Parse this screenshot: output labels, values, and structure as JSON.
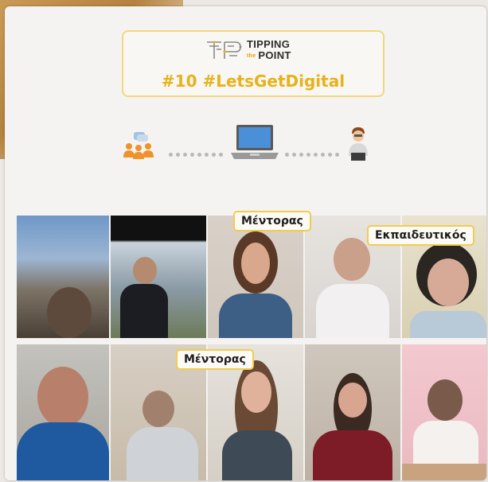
{
  "logo": {
    "line1": "TIPPING",
    "small": "the",
    "line2": "POINT"
  },
  "banner": {
    "hashtag": "#10 #LetsGetDigital"
  },
  "diagram": {
    "left_icon": "group-chat-icon",
    "center_icon": "laptop-icon",
    "right_icon": "person-with-laptop-icon"
  },
  "labels": {
    "mentor_top": "Μέντορας",
    "teacher": "Εκπαιδευτικός",
    "mentor_bottom": "Μέντορας"
  },
  "colors": {
    "accent": "#e7b21a",
    "border": "#f2cc4e",
    "people": "#f0922b",
    "laptop": "#4a8fd8"
  }
}
